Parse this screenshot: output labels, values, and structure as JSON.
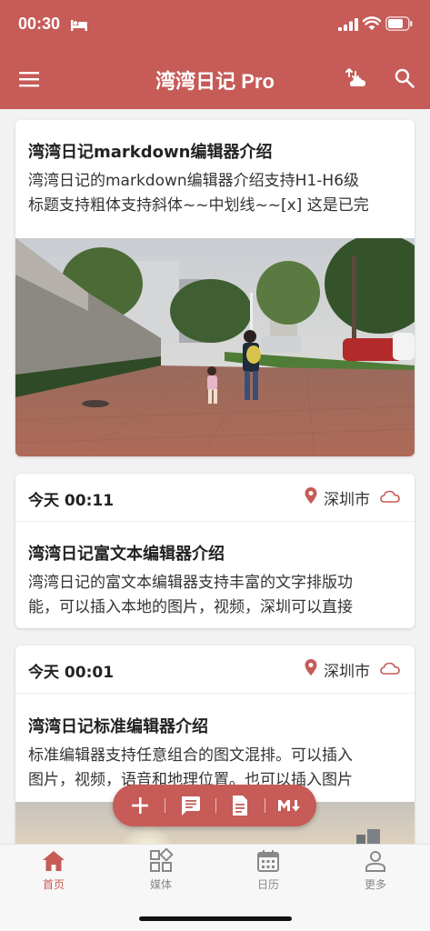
{
  "status_bar": {
    "time": "00:30"
  },
  "header": {
    "title": "湾湾日记 Pro"
  },
  "entries": [
    {
      "title": "湾湾日记markdown编辑器介绍",
      "body": [
        "湾湾日记的markdown编辑器介绍支持H1-H6级",
        "标题支持粗体支持斜体~~中划线~~[x] 这是已完"
      ]
    },
    {
      "date": "今天 00:11",
      "location": "深圳市",
      "title": "湾湾日记富文本编辑器介绍",
      "body": [
        "湾湾日记的富文本编辑器支持丰富的文字排版功",
        "能，可以插入本地的图片，视频，深圳可以直接"
      ]
    },
    {
      "date": "今天 00:01",
      "location": "深圳市",
      "title": "湾湾日记标准编辑器介绍",
      "body": [
        "标准编辑器支持任意组合的图文混排。可以插入",
        "图片，视频，语音和地理位置。也可以插入图片"
      ]
    }
  ],
  "bottom_nav": [
    {
      "label": "首页",
      "icon": "home-icon",
      "active": true
    },
    {
      "label": "媒体",
      "icon": "grid-icon",
      "active": false
    },
    {
      "label": "日历",
      "icon": "calendar-icon",
      "active": false
    },
    {
      "label": "更多",
      "icon": "person-icon",
      "active": false
    }
  ],
  "toolbar": {
    "icons": [
      "plus-icon",
      "comment-icon",
      "document-icon",
      "markdown-icon"
    ]
  },
  "colors": {
    "accent": "#c65b57",
    "background": "#f2f2f2",
    "card": "#ffffff"
  }
}
